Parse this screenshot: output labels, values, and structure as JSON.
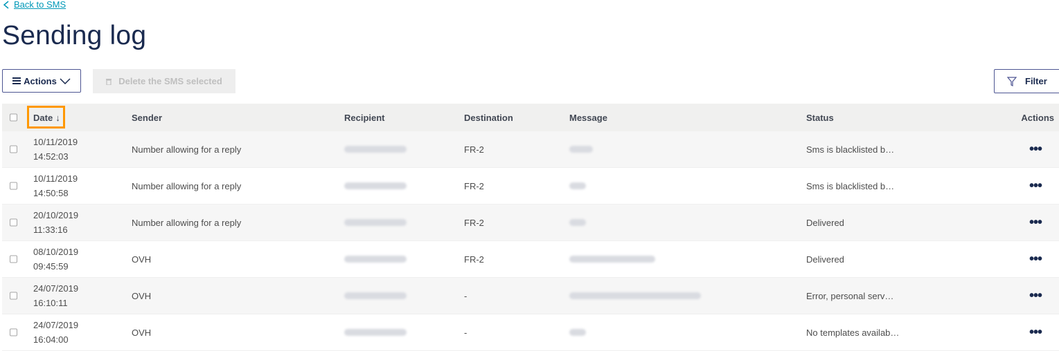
{
  "nav": {
    "back_label": "Back to SMS"
  },
  "page": {
    "title": "Sending log"
  },
  "toolbar": {
    "actions_label": "Actions",
    "delete_label": "Delete the SMS selected",
    "filter_label": "Filter"
  },
  "table": {
    "columns": {
      "date": "Date",
      "sender": "Sender",
      "recipient": "Recipient",
      "destination": "Destination",
      "message": "Message",
      "status": "Status",
      "actions": "Actions"
    },
    "sort_indicator": "↓",
    "rows": [
      {
        "date": "10/11/2019",
        "time": "14:52:03",
        "sender": "Number allowing for a reply",
        "destination": "FR-2",
        "status": "Sms is blacklisted b…"
      },
      {
        "date": "10/11/2019",
        "time": "14:50:58",
        "sender": "Number allowing for a reply",
        "destination": "FR-2",
        "status": "Sms is blacklisted b…"
      },
      {
        "date": "20/10/2019",
        "time": "11:33:16",
        "sender": "Number allowing for a reply",
        "destination": "FR-2",
        "status": "Delivered"
      },
      {
        "date": "08/10/2019",
        "time": "09:45:59",
        "sender": "OVH",
        "destination": "FR-2",
        "status": "Delivered"
      },
      {
        "date": "24/07/2019",
        "time": "16:10:11",
        "sender": "OVH",
        "destination": "-",
        "status": "Error, personal serv…"
      },
      {
        "date": "24/07/2019",
        "time": "16:04:00",
        "sender": "OVH",
        "destination": "-",
        "status": "No templates availab…"
      }
    ],
    "row_menu_glyph": "•••"
  },
  "icons": {
    "back": "chevron-left-icon",
    "menu": "hamburger-icon",
    "dropdown": "chevron-down-icon",
    "trash": "trash-icon",
    "filter": "filter-funnel-icon",
    "row_menu": "ellipsis-icon"
  },
  "colors": {
    "link": "#0098b8",
    "primary_text": "#1a2a4f",
    "border": "#4d5592",
    "highlight": "#ff9800",
    "header_bg": "#f0f0ef"
  }
}
